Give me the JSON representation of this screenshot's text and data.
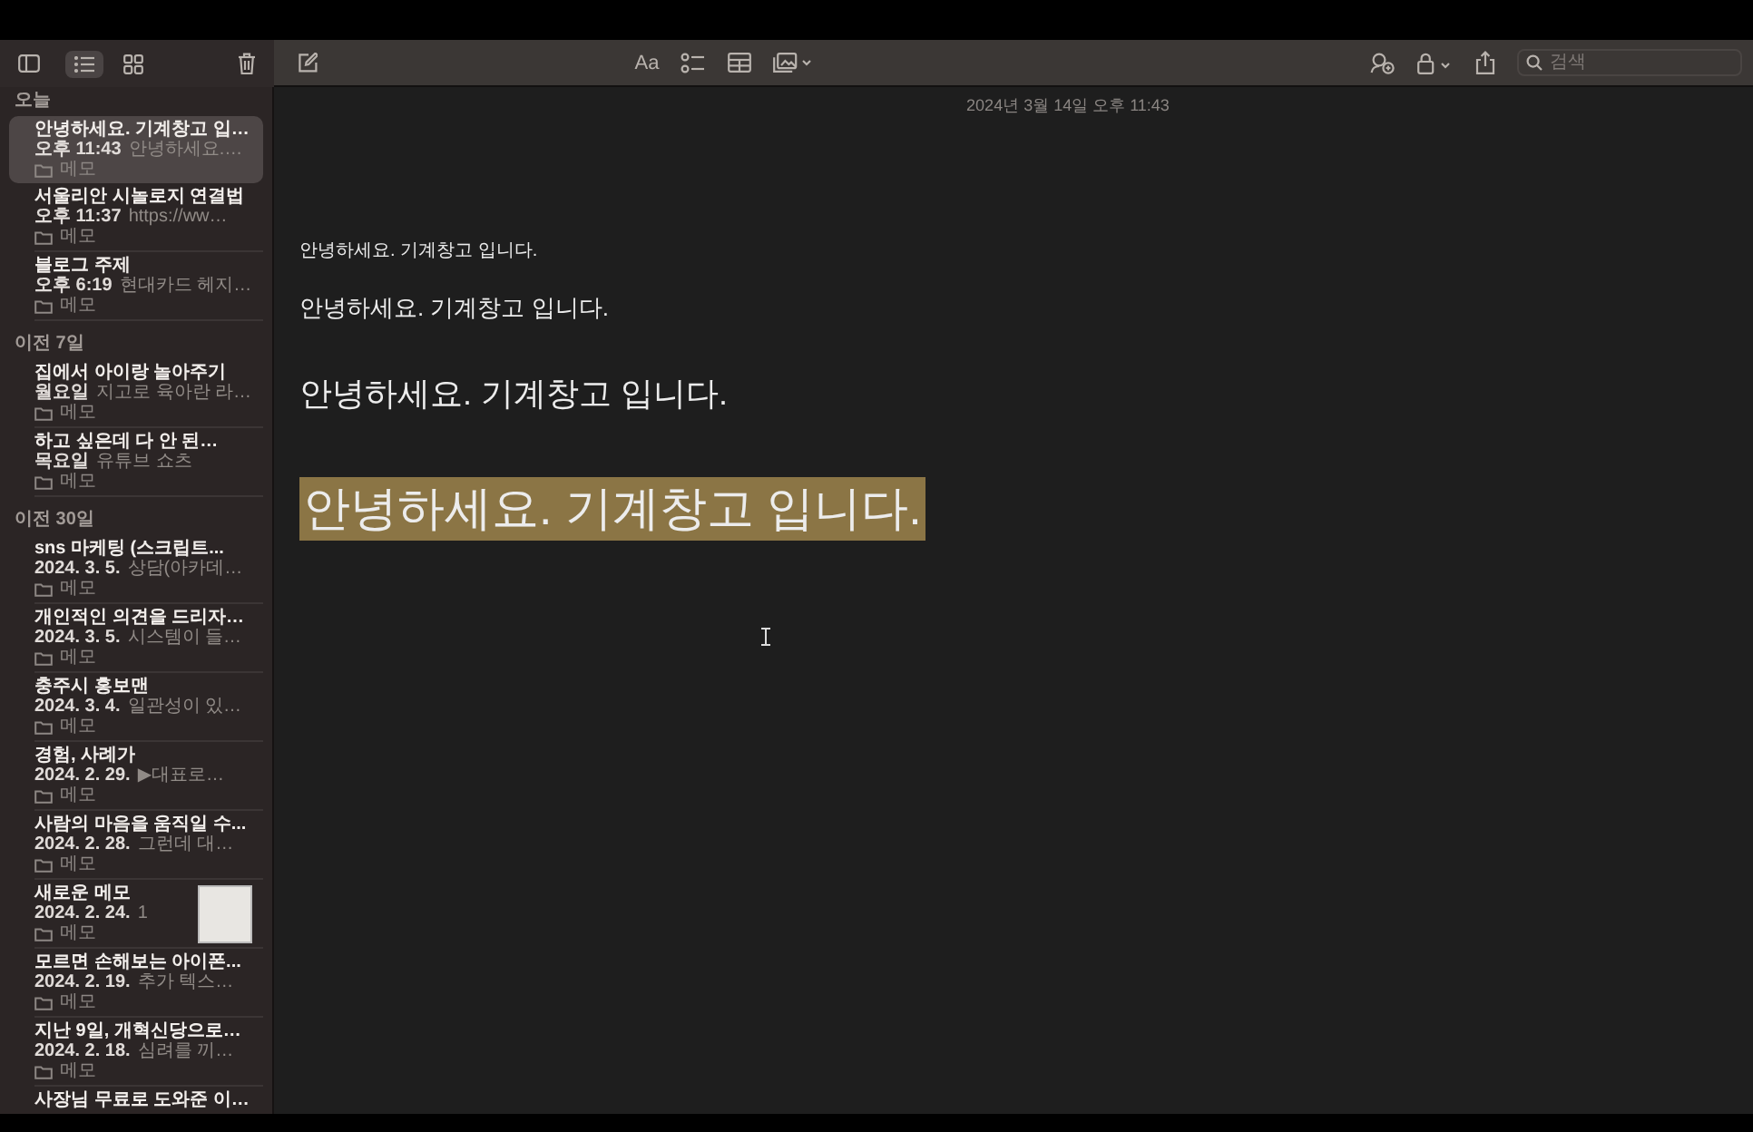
{
  "sidebar_toolbar": {
    "view_modes": [
      {
        "kind": "list",
        "selected": true
      },
      {
        "kind": "gallery",
        "selected": false
      }
    ]
  },
  "sidebar": {
    "sections": [
      {
        "title": "오늘",
        "notes": [
          {
            "title": "안녕하세요. 기계창고 입…",
            "date": "오후 11:43",
            "preview": "안녕하세요.…",
            "folder": "메모",
            "selected": true
          },
          {
            "title": "서울리안 시놀로지 연결법",
            "date": "오후 11:37",
            "preview": "https://ww…",
            "folder": "메모",
            "selected": false
          },
          {
            "title": "블로그 주제",
            "date": "오후 6:19",
            "preview": "현대카드 헤지…",
            "folder": "메모",
            "selected": false
          }
        ]
      },
      {
        "title": "이전 7일",
        "notes": [
          {
            "title": "집에서 아이랑 놀아주기",
            "date": "월요일",
            "preview": "지고로 육아란 라…",
            "folder": "메모",
            "selected": false
          },
          {
            "title": "하고 싶은데 다 안 된…",
            "date": "목요일",
            "preview": "유튜브 쇼츠",
            "folder": "메모",
            "selected": false
          }
        ]
      },
      {
        "title": "이전 30일",
        "notes": [
          {
            "title": "sns 마케팅 (스크립트...",
            "date": "2024. 3. 5.",
            "preview": "상담(아카데…",
            "folder": "메모",
            "selected": false
          },
          {
            "title": "개인적인 의견을 드리자…",
            "date": "2024. 3. 5.",
            "preview": "시스템이 들…",
            "folder": "메모",
            "selected": false
          },
          {
            "title": "충주시 홍보맨",
            "date": "2024. 3. 4.",
            "preview": "일관성이 있…",
            "folder": "메모",
            "selected": false
          },
          {
            "title": "경험, 사례가",
            "date": "2024. 2. 29.",
            "preview": "▶대표로…",
            "folder": "메모",
            "selected": false
          },
          {
            "title": "사람의 마음을 움직일 수...",
            "date": "2024. 2. 28.",
            "preview": "그런데 대…",
            "folder": "메모",
            "selected": false
          },
          {
            "title": "새로운 메모",
            "date": "2024. 2. 24.",
            "preview": "1",
            "folder": "메모",
            "selected": false,
            "thumbnail": true
          },
          {
            "title": "모르면 손해보는 아이폰...",
            "date": "2024. 2. 19.",
            "preview": "추가 텍스…",
            "folder": "메모",
            "selected": false
          },
          {
            "title": "지난 9일, 개혁신당으로…",
            "date": "2024. 2. 18.",
            "preview": "심려를 끼…",
            "folder": "메모",
            "selected": false
          },
          {
            "title": "사장님 무료로 도와준 이…",
            "selected": false
          }
        ]
      }
    ]
  },
  "toolbar": {
    "format_label": "Aa",
    "search": {
      "placeholder": "검색"
    }
  },
  "editor": {
    "date": "2024년 3월 14일 오후 11:43",
    "paragraphs": [
      {
        "kind": "caption",
        "text": "안녕하세요. 기계창고 입니다.",
        "highlighted": false
      },
      {
        "kind": "body",
        "text": "안녕하세요. 기계창고 입니다.",
        "highlighted": false
      },
      {
        "kind": "heading",
        "text": "안녕하세요. 기계창고 입니다.",
        "highlighted": false
      },
      {
        "kind": "title",
        "text": "안녕하세요. 기계창고 입니다.",
        "highlighted": true
      }
    ]
  }
}
